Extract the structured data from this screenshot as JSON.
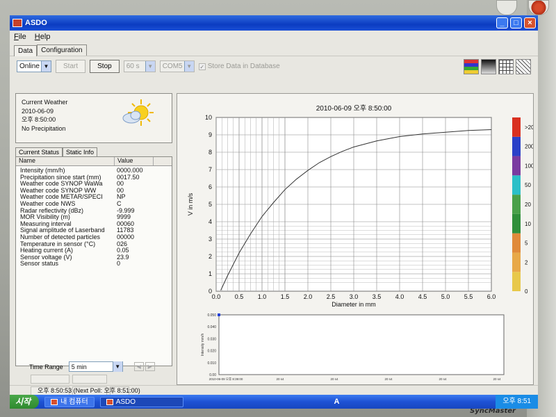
{
  "window": {
    "title": "ASDO"
  },
  "menu": [
    {
      "label": "File"
    },
    {
      "label": "Help"
    }
  ],
  "tabs": [
    {
      "label": "Data"
    },
    {
      "label": "Configuration"
    }
  ],
  "toolbar": {
    "mode_value": "Online",
    "start_label": "Start",
    "stop_label": "Stop",
    "interval_value": "60 s",
    "port_value": "COM5",
    "store_label": "Store Data in Database"
  },
  "weather": {
    "title": "Current Weather",
    "date": "2010-06-09",
    "time": "오후 8:50:00",
    "condition": "No Precipitation",
    "icon": "partly-cloudy-sun-icon"
  },
  "subtabs": [
    {
      "label": "Current Status"
    },
    {
      "label": "Static Info"
    }
  ],
  "status_table": {
    "headers": [
      "Name",
      "Value"
    ],
    "rows": [
      {
        "name": "Intensity (mm/h)",
        "value": "0000.000"
      },
      {
        "name": "Precipitation since start (mm)",
        "value": "0017.50"
      },
      {
        "name": "Weather code SYNOP WaWa",
        "value": "00"
      },
      {
        "name": "Weather code SYNOP WW",
        "value": "00"
      },
      {
        "name": "Weather code METAR/SPECI",
        "value": "NP"
      },
      {
        "name": "Weather code NWS",
        "value": "C"
      },
      {
        "name": "Radar reflectivity (dBz)",
        "value": "-9.999"
      },
      {
        "name": "MOR Visibility (m)",
        "value": "9999"
      },
      {
        "name": "Measuring interval",
        "value": "00060"
      },
      {
        "name": "Signal amplitude of Laserband",
        "value": "11783"
      },
      {
        "name": "Number of detected particles",
        "value": "00000"
      },
      {
        "name": "Temperature in sensor (°C)",
        "value": "026"
      },
      {
        "name": "Heating current (A)",
        "value": "0.05"
      },
      {
        "name": "Sensor voltage (V)",
        "value": "23.9"
      },
      {
        "name": "Sensor status",
        "value": "0"
      }
    ]
  },
  "time_range": {
    "label": "Time Range",
    "value": "5 min"
  },
  "chart_title": "2010-06-09 오후 8:50:00",
  "chart_data": [
    {
      "type": "line",
      "title": "2010-06-09 오후 8:50:00",
      "xlabel": "Diameter in mm",
      "ylabel": "V in m/s",
      "xlim": [
        0.0,
        6.0
      ],
      "ylim": [
        0,
        10
      ],
      "grid": true,
      "x_ticks": [
        "0.0",
        "0.5",
        "1.0",
        "1.5",
        "2.0",
        "2.5",
        "3.0",
        "3.5",
        "4.0",
        "4.5",
        "5.0",
        "5.5",
        "6.0"
      ],
      "y_ticks": [
        "0",
        "1",
        "2",
        "3",
        "4",
        "5",
        "6",
        "7",
        "8",
        "9",
        "10"
      ],
      "series": [
        {
          "x": [
            0.1,
            0.25,
            0.5,
            0.75,
            1.0,
            1.25,
            1.5,
            1.75,
            2.0,
            2.25,
            2.5,
            2.75,
            3.0,
            3.5,
            4.0,
            4.5,
            5.0,
            5.5,
            6.0
          ],
          "values": [
            0.05,
            0.9,
            2.2,
            3.3,
            4.3,
            5.1,
            5.85,
            6.45,
            6.95,
            7.4,
            7.75,
            8.05,
            8.3,
            8.65,
            8.9,
            9.05,
            9.15,
            9.25,
            9.3
          ]
        }
      ],
      "colorbar": [
        "0",
        "2",
        "5",
        "10",
        "20",
        "50",
        "100",
        "200",
        ">200"
      ],
      "colorbar_colors": [
        "#e8c84a",
        "#e8a848",
        "#e08a3a",
        "#2f8f3a",
        "#49a049",
        "#2bbfc8",
        "#7a3aa0",
        "#2a40c8",
        "#d93020"
      ]
    },
    {
      "type": "line",
      "xlabel": "",
      "ylabel": "Intensity mm/h",
      "ylim": [
        0,
        0.05
      ],
      "y_ticks": [
        "0.00",
        "0.010",
        "0.020",
        "0.030",
        "0.040",
        "0.050"
      ],
      "x_ticks": [
        "2010-06-09 오후 8:39:00",
        "20 s4",
        "20 s4",
        "20 s4",
        "20 s4",
        "20 s4"
      ],
      "series": [
        {
          "values": [
            0.05
          ]
        }
      ]
    }
  ],
  "statusbar": {
    "text": "오후 8:50:53 (Next Poll: 오후 8:51:00)"
  },
  "taskbar": {
    "start_label": "시작",
    "items": [
      {
        "label": "내 컴퓨터"
      },
      {
        "label": "ASDO"
      }
    ],
    "lang": "A",
    "clock": "오후 8:51"
  },
  "monitor": {
    "brand": "SyncMaster"
  }
}
